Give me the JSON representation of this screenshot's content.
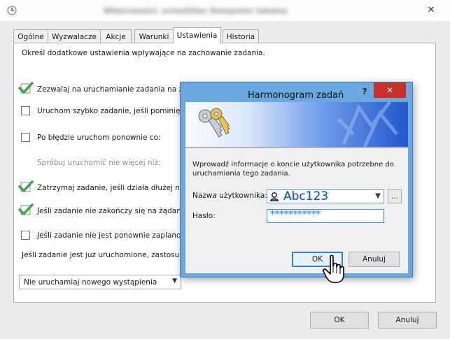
{
  "main_window": {
    "title": "Właściwości: sched2tier Komputer lokalny",
    "close_label": "✕",
    "tabs": [
      {
        "label": "Ogólne"
      },
      {
        "label": "Wyzwalacze"
      },
      {
        "label": "Akcje"
      },
      {
        "label": "Warunki"
      },
      {
        "label": "Ustawienia"
      },
      {
        "label": "Historia"
      }
    ],
    "active_tab": "Ustawienia",
    "description": "Określ dodatkowe ustawienia wpływające na zachowanie zadania.",
    "settings": [
      {
        "label": "Zezwalaj na uruchamianie zadania na ż",
        "checked": true
      },
      {
        "label": "Uruchom szybko zadanie, jeśli pominię",
        "checked": false
      },
      {
        "label": "Po błędzie uruchom ponownie co:",
        "checked": false
      },
      {
        "label": "Spróbuj uruchomić nie więcej niż:",
        "disabled": true
      },
      {
        "label": "Zatrzymaj zadanie, jeśli działa dłużej ni",
        "checked": true
      },
      {
        "label": "Jeśli zadanie nie zakończy się na żądan",
        "checked": true
      },
      {
        "label": "Jeśli zadanie nie jest ponownie zaplano",
        "checked": false
      }
    ],
    "policy_label": "Jeśli zadanie jest już uruchomione, zastosu",
    "policy_value": "Nie uruchamiaj nowego wystąpienia",
    "ok_label": "OK",
    "cancel_label": "Anuluj"
  },
  "dialog": {
    "title": "Harmonogram zadań",
    "help_label": "?",
    "close_label": "✕",
    "info": "Wprowadź informacje o koncie użytkownika potrzebne do uruchamiania tego zadania.",
    "username_label": "Nazwa użytkownika:",
    "username_value": "Abc123",
    "browse_label": "...",
    "password_label": "Hasło:",
    "password_value": "***********",
    "ok_label": "OK",
    "cancel_label": "Anuluj"
  },
  "colors": {
    "checkmark": "#3aa64a",
    "dialog_frame": "#6ca8e0",
    "close_button": "#c7302b",
    "ok_focus": "#3c7fd6"
  },
  "icons": [
    "clock-icon",
    "keys-icon",
    "user-icon",
    "hand-cursor-icon",
    "checkmark-icon"
  ]
}
